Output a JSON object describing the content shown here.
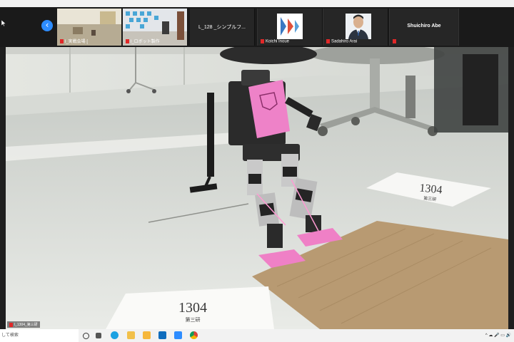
{
  "participants": [
    {
      "name": "l_実戦会場 [",
      "muted": true,
      "kind": "video-room"
    },
    {
      "name": "l_ロボット製作",
      "muted": true,
      "kind": "video-robot"
    },
    {
      "title": "L_128 _シンプルフ...",
      "muted": false,
      "kind": "title"
    },
    {
      "name": "Koichi Inoue",
      "muted": true,
      "kind": "logo"
    },
    {
      "name": "Sadahiro Arai",
      "muted": true,
      "kind": "person"
    },
    {
      "title": "Shuichiro Abe",
      "muted": true,
      "kind": "title"
    }
  ],
  "main_video": {
    "label": "l_1304_第三研",
    "paper_large": "1304",
    "paper_large_sub": "第三研",
    "paper_small": "1304",
    "paper_small_sub": "第三研"
  },
  "taskbar": {
    "search_placeholder": "して検索",
    "app_icons": [
      "task-view-icon",
      "edge-icon",
      "file-explorer-icon",
      "mail-icon",
      "store-icon",
      "zoom-icon",
      "chrome-icon"
    ],
    "tray": "^ ☁ 🎤 ▭ 🔊"
  },
  "colors": {
    "zoom_blue": "#2d8cff",
    "mute_red": "#e02828",
    "robot_pink": "#ee82c8"
  }
}
